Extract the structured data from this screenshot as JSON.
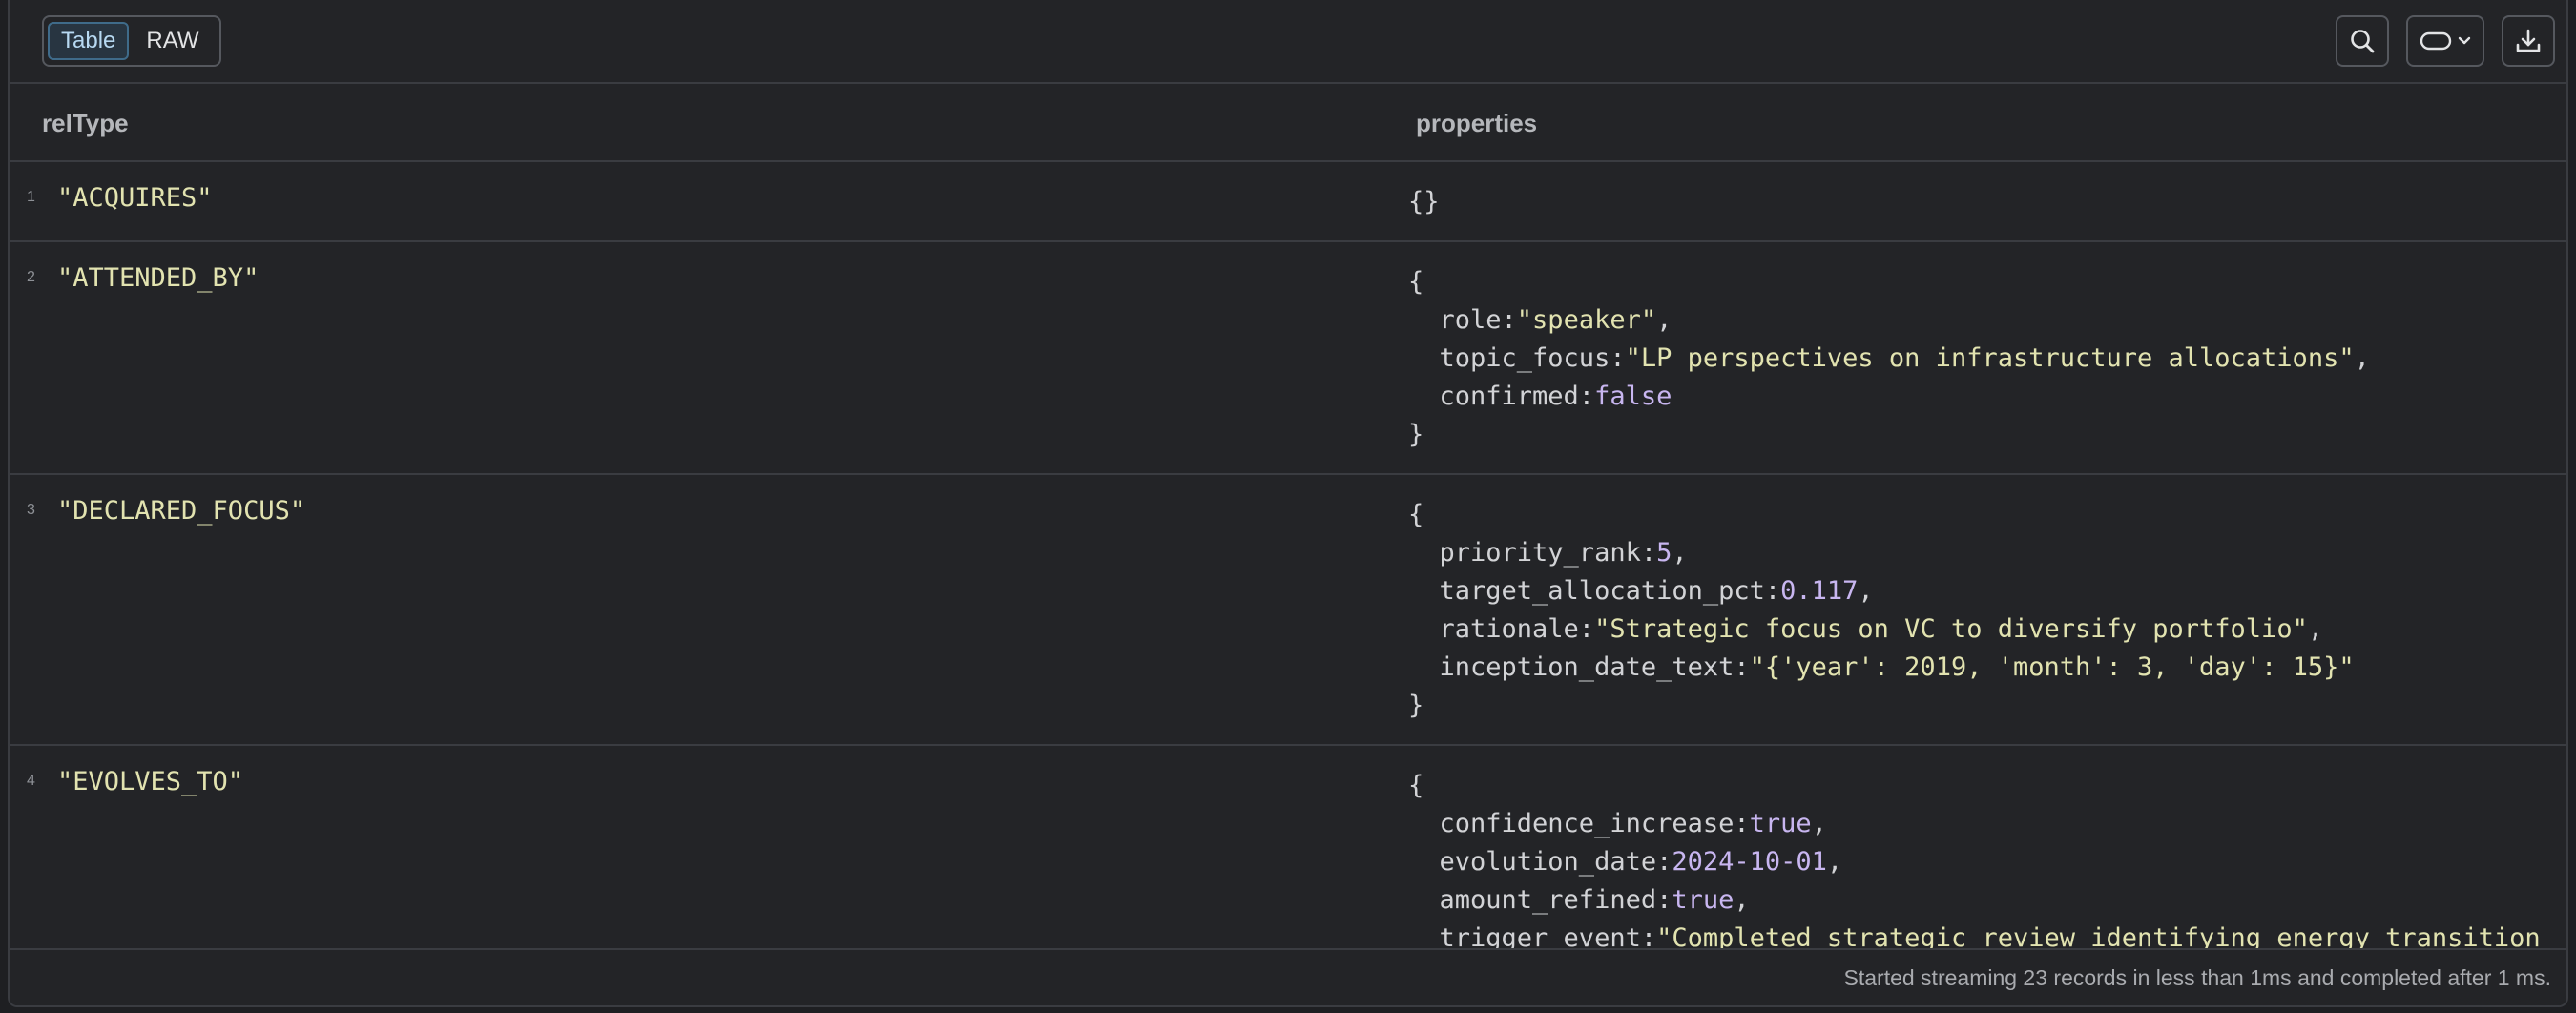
{
  "toolbar": {
    "view_tabs": [
      {
        "label": "Table",
        "active": true
      },
      {
        "label": "RAW",
        "active": false
      }
    ],
    "icons": [
      "search-icon",
      "pill-shape-icon",
      "chevron-down-icon",
      "download-icon"
    ]
  },
  "table": {
    "columns": [
      "relType",
      "properties"
    ],
    "rows": [
      {
        "num": "1",
        "relType": "\"ACQUIRES\"",
        "props": [
          "{}"
        ]
      },
      {
        "num": "2",
        "relType": "\"ATTENDED_BY\"",
        "props": [
          "{",
          "  role:|\"speaker\"|,",
          "  topic_focus:|\"LP perspectives on infrastructure allocations\"|,",
          "  confirmed:|false|",
          "}"
        ]
      },
      {
        "num": "3",
        "relType": "\"DECLARED_FOCUS\"",
        "props": [
          "{",
          "  priority_rank:|5|,",
          "  target_allocation_pct:|0.117|,",
          "  rationale:|\"Strategic focus on VC to diversify portfolio\"|,",
          "  inception_date_text:|\"{'year': 2019, 'month': 3, 'day': 15}\"|",
          "}"
        ]
      },
      {
        "num": "4",
        "relType": "\"EVOLVES_TO\"",
        "props": [
          "{",
          "  confidence_increase:|true|,",
          "  evolution_date:|2024-10-01|,",
          "  amount_refined:|true|,",
          "  trigger_event:|\"Completed strategic review identifying energy transition"
        ]
      }
    ]
  },
  "footer": {
    "status": "Started streaming 23 records in less than 1ms and completed after 1 ms."
  },
  "colors": {
    "string": "#e2e3b0",
    "number_bool": "#c8b6f0",
    "key": "#d2d3d6"
  }
}
